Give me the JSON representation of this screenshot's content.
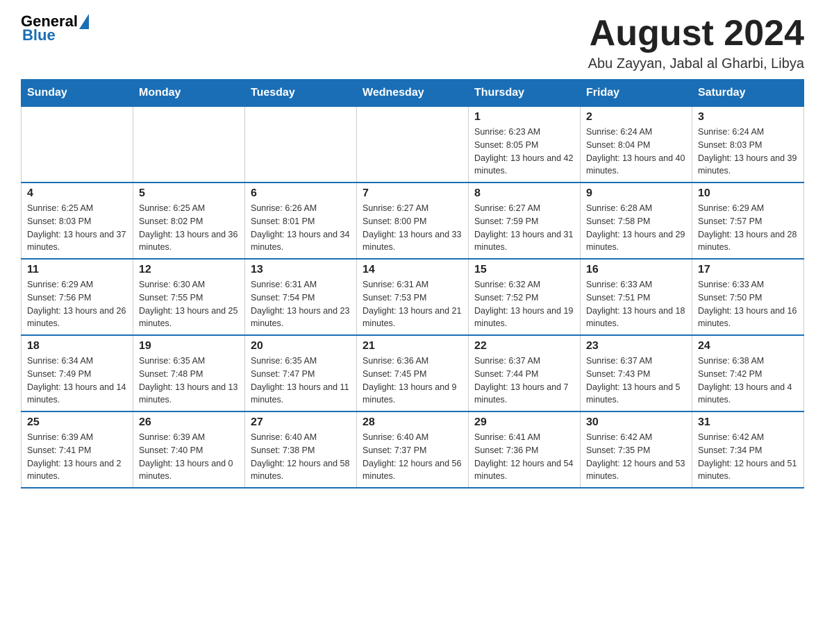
{
  "header": {
    "logo": {
      "general": "General",
      "blue": "Blue",
      "triangle_color": "#1a6eb5"
    },
    "title": "August 2024",
    "location": "Abu Zayyan, Jabal al Gharbi, Libya"
  },
  "weekdays": [
    "Sunday",
    "Monday",
    "Tuesday",
    "Wednesday",
    "Thursday",
    "Friday",
    "Saturday"
  ],
  "weeks": [
    [
      {
        "day": "",
        "info": ""
      },
      {
        "day": "",
        "info": ""
      },
      {
        "day": "",
        "info": ""
      },
      {
        "day": "",
        "info": ""
      },
      {
        "day": "1",
        "info": "Sunrise: 6:23 AM\nSunset: 8:05 PM\nDaylight: 13 hours and 42 minutes."
      },
      {
        "day": "2",
        "info": "Sunrise: 6:24 AM\nSunset: 8:04 PM\nDaylight: 13 hours and 40 minutes."
      },
      {
        "day": "3",
        "info": "Sunrise: 6:24 AM\nSunset: 8:03 PM\nDaylight: 13 hours and 39 minutes."
      }
    ],
    [
      {
        "day": "4",
        "info": "Sunrise: 6:25 AM\nSunset: 8:03 PM\nDaylight: 13 hours and 37 minutes."
      },
      {
        "day": "5",
        "info": "Sunrise: 6:25 AM\nSunset: 8:02 PM\nDaylight: 13 hours and 36 minutes."
      },
      {
        "day": "6",
        "info": "Sunrise: 6:26 AM\nSunset: 8:01 PM\nDaylight: 13 hours and 34 minutes."
      },
      {
        "day": "7",
        "info": "Sunrise: 6:27 AM\nSunset: 8:00 PM\nDaylight: 13 hours and 33 minutes."
      },
      {
        "day": "8",
        "info": "Sunrise: 6:27 AM\nSunset: 7:59 PM\nDaylight: 13 hours and 31 minutes."
      },
      {
        "day": "9",
        "info": "Sunrise: 6:28 AM\nSunset: 7:58 PM\nDaylight: 13 hours and 29 minutes."
      },
      {
        "day": "10",
        "info": "Sunrise: 6:29 AM\nSunset: 7:57 PM\nDaylight: 13 hours and 28 minutes."
      }
    ],
    [
      {
        "day": "11",
        "info": "Sunrise: 6:29 AM\nSunset: 7:56 PM\nDaylight: 13 hours and 26 minutes."
      },
      {
        "day": "12",
        "info": "Sunrise: 6:30 AM\nSunset: 7:55 PM\nDaylight: 13 hours and 25 minutes."
      },
      {
        "day": "13",
        "info": "Sunrise: 6:31 AM\nSunset: 7:54 PM\nDaylight: 13 hours and 23 minutes."
      },
      {
        "day": "14",
        "info": "Sunrise: 6:31 AM\nSunset: 7:53 PM\nDaylight: 13 hours and 21 minutes."
      },
      {
        "day": "15",
        "info": "Sunrise: 6:32 AM\nSunset: 7:52 PM\nDaylight: 13 hours and 19 minutes."
      },
      {
        "day": "16",
        "info": "Sunrise: 6:33 AM\nSunset: 7:51 PM\nDaylight: 13 hours and 18 minutes."
      },
      {
        "day": "17",
        "info": "Sunrise: 6:33 AM\nSunset: 7:50 PM\nDaylight: 13 hours and 16 minutes."
      }
    ],
    [
      {
        "day": "18",
        "info": "Sunrise: 6:34 AM\nSunset: 7:49 PM\nDaylight: 13 hours and 14 minutes."
      },
      {
        "day": "19",
        "info": "Sunrise: 6:35 AM\nSunset: 7:48 PM\nDaylight: 13 hours and 13 minutes."
      },
      {
        "day": "20",
        "info": "Sunrise: 6:35 AM\nSunset: 7:47 PM\nDaylight: 13 hours and 11 minutes."
      },
      {
        "day": "21",
        "info": "Sunrise: 6:36 AM\nSunset: 7:45 PM\nDaylight: 13 hours and 9 minutes."
      },
      {
        "day": "22",
        "info": "Sunrise: 6:37 AM\nSunset: 7:44 PM\nDaylight: 13 hours and 7 minutes."
      },
      {
        "day": "23",
        "info": "Sunrise: 6:37 AM\nSunset: 7:43 PM\nDaylight: 13 hours and 5 minutes."
      },
      {
        "day": "24",
        "info": "Sunrise: 6:38 AM\nSunset: 7:42 PM\nDaylight: 13 hours and 4 minutes."
      }
    ],
    [
      {
        "day": "25",
        "info": "Sunrise: 6:39 AM\nSunset: 7:41 PM\nDaylight: 13 hours and 2 minutes."
      },
      {
        "day": "26",
        "info": "Sunrise: 6:39 AM\nSunset: 7:40 PM\nDaylight: 13 hours and 0 minutes."
      },
      {
        "day": "27",
        "info": "Sunrise: 6:40 AM\nSunset: 7:38 PM\nDaylight: 12 hours and 58 minutes."
      },
      {
        "day": "28",
        "info": "Sunrise: 6:40 AM\nSunset: 7:37 PM\nDaylight: 12 hours and 56 minutes."
      },
      {
        "day": "29",
        "info": "Sunrise: 6:41 AM\nSunset: 7:36 PM\nDaylight: 12 hours and 54 minutes."
      },
      {
        "day": "30",
        "info": "Sunrise: 6:42 AM\nSunset: 7:35 PM\nDaylight: 12 hours and 53 minutes."
      },
      {
        "day": "31",
        "info": "Sunrise: 6:42 AM\nSunset: 7:34 PM\nDaylight: 12 hours and 51 minutes."
      }
    ]
  ]
}
